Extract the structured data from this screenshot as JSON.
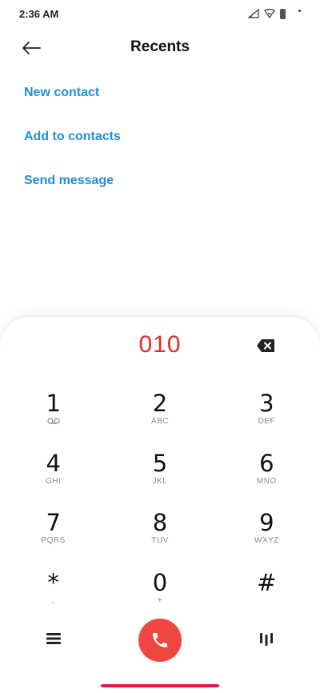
{
  "status_bar": {
    "time": "2:36 AM"
  },
  "header": {
    "title": "Recents",
    "back_icon": "arrow-left-icon"
  },
  "actions": [
    {
      "label": "New contact"
    },
    {
      "label": "Add to contacts"
    },
    {
      "label": "Send message"
    }
  ],
  "dialpad": {
    "number": "010",
    "keys": [
      {
        "digit": "1",
        "letters": ""
      },
      {
        "digit": "2",
        "letters": "ABC"
      },
      {
        "digit": "3",
        "letters": "DEF"
      },
      {
        "digit": "4",
        "letters": "GHI"
      },
      {
        "digit": "5",
        "letters": "JKL"
      },
      {
        "digit": "6",
        "letters": "MNO"
      },
      {
        "digit": "7",
        "letters": "PQRS"
      },
      {
        "digit": "8",
        "letters": "TUV"
      },
      {
        "digit": "9",
        "letters": "WXYZ"
      },
      {
        "digit": "*",
        "letters": ","
      },
      {
        "digit": "0",
        "letters": "+"
      },
      {
        "digit": "#",
        "letters": ""
      }
    ]
  },
  "colors": {
    "accent_link": "#1f8fd6",
    "dialed_number": "#e02b2b",
    "call_button": "#f1463f",
    "home_indicator": "#e8174a"
  }
}
